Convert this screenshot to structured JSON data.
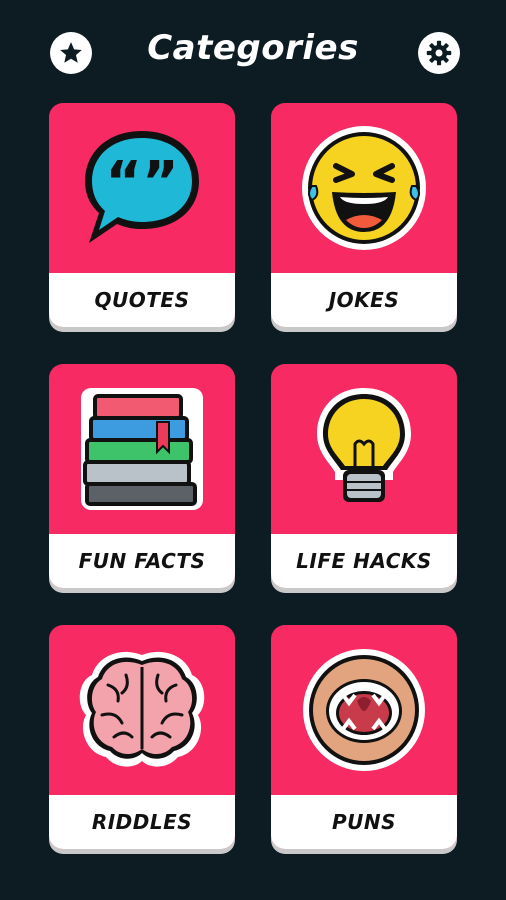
{
  "header": {
    "title": "Categories",
    "left_icon": "star-icon",
    "right_icon": "gear-icon"
  },
  "colors": {
    "background": "#0d1b23",
    "card": "#f72a63",
    "label_bg": "#ffffff"
  },
  "categories": [
    {
      "label": "QUOTES",
      "icon": "speech-bubble-icon"
    },
    {
      "label": "JOKES",
      "icon": "laughing-face-icon"
    },
    {
      "label": "FUN FACTS",
      "icon": "books-icon"
    },
    {
      "label": "LIFE HACKS",
      "icon": "light-bulb-icon"
    },
    {
      "label": "RIDDLES",
      "icon": "brain-icon"
    },
    {
      "label": "PUNS",
      "icon": "open-mouth-icon"
    }
  ]
}
